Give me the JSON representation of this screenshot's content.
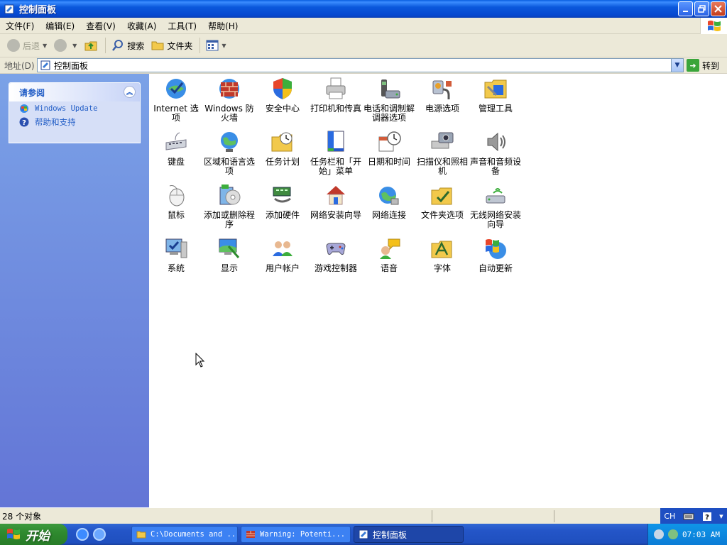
{
  "window": {
    "title": "控制面板"
  },
  "menu": [
    "文件(F)",
    "编辑(E)",
    "查看(V)",
    "收藏(A)",
    "工具(T)",
    "帮助(H)"
  ],
  "toolbar": {
    "back": "后退",
    "search": "搜索",
    "folders": "文件夹"
  },
  "address": {
    "label": "地址(D)",
    "value": "控制面板",
    "go": "转到"
  },
  "see_also": {
    "title": "请参阅",
    "links": [
      "Windows Update",
      "帮助和支持"
    ]
  },
  "items": [
    "Internet 选项",
    "Windows 防火墙",
    "安全中心",
    "打印机和传真",
    "电话和调制解调器选项",
    "电源选项",
    "管理工具",
    "键盘",
    "区域和语言选项",
    "任务计划",
    "任务栏和「开始」菜单",
    "日期和时间",
    "扫描仪和照相机",
    "声音和音频设备",
    "鼠标",
    "添加或删除程序",
    "添加硬件",
    "网络安装向导",
    "网络连接",
    "文件夹选项",
    "无线网络安装向导",
    "系统",
    "显示",
    "用户帐户",
    "游戏控制器",
    "语音",
    "字体",
    "自动更新"
  ],
  "status": {
    "text": "28 个对象",
    "lang": "CH"
  },
  "taskbar": {
    "start": "开始",
    "tasks": [
      "C:\\Documents and ...",
      "Warning: Potenti...",
      "控制面板"
    ],
    "clock": "07:03 AM"
  },
  "colors": {
    "title_blue": "#0b58dc",
    "pane_blue": "#7ba2e7",
    "start_green": "#2f8a2f"
  }
}
